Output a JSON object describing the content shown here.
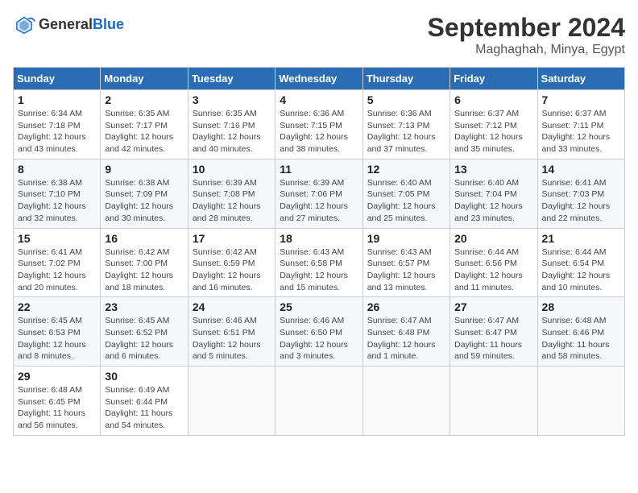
{
  "header": {
    "logo_general": "General",
    "logo_blue": "Blue",
    "month_title": "September 2024",
    "location": "Maghaghah, Minya, Egypt"
  },
  "days_of_week": [
    "Sunday",
    "Monday",
    "Tuesday",
    "Wednesday",
    "Thursday",
    "Friday",
    "Saturday"
  ],
  "weeks": [
    [
      {
        "day": "1",
        "sunrise": "6:34 AM",
        "sunset": "7:18 PM",
        "daylight": "12 hours and 43 minutes."
      },
      {
        "day": "2",
        "sunrise": "6:35 AM",
        "sunset": "7:17 PM",
        "daylight": "12 hours and 42 minutes."
      },
      {
        "day": "3",
        "sunrise": "6:35 AM",
        "sunset": "7:16 PM",
        "daylight": "12 hours and 40 minutes."
      },
      {
        "day": "4",
        "sunrise": "6:36 AM",
        "sunset": "7:15 PM",
        "daylight": "12 hours and 38 minutes."
      },
      {
        "day": "5",
        "sunrise": "6:36 AM",
        "sunset": "7:13 PM",
        "daylight": "12 hours and 37 minutes."
      },
      {
        "day": "6",
        "sunrise": "6:37 AM",
        "sunset": "7:12 PM",
        "daylight": "12 hours and 35 minutes."
      },
      {
        "day": "7",
        "sunrise": "6:37 AM",
        "sunset": "7:11 PM",
        "daylight": "12 hours and 33 minutes."
      }
    ],
    [
      {
        "day": "8",
        "sunrise": "6:38 AM",
        "sunset": "7:10 PM",
        "daylight": "12 hours and 32 minutes."
      },
      {
        "day": "9",
        "sunrise": "6:38 AM",
        "sunset": "7:09 PM",
        "daylight": "12 hours and 30 minutes."
      },
      {
        "day": "10",
        "sunrise": "6:39 AM",
        "sunset": "7:08 PM",
        "daylight": "12 hours and 28 minutes."
      },
      {
        "day": "11",
        "sunrise": "6:39 AM",
        "sunset": "7:06 PM",
        "daylight": "12 hours and 27 minutes."
      },
      {
        "day": "12",
        "sunrise": "6:40 AM",
        "sunset": "7:05 PM",
        "daylight": "12 hours and 25 minutes."
      },
      {
        "day": "13",
        "sunrise": "6:40 AM",
        "sunset": "7:04 PM",
        "daylight": "12 hours and 23 minutes."
      },
      {
        "day": "14",
        "sunrise": "6:41 AM",
        "sunset": "7:03 PM",
        "daylight": "12 hours and 22 minutes."
      }
    ],
    [
      {
        "day": "15",
        "sunrise": "6:41 AM",
        "sunset": "7:02 PM",
        "daylight": "12 hours and 20 minutes."
      },
      {
        "day": "16",
        "sunrise": "6:42 AM",
        "sunset": "7:00 PM",
        "daylight": "12 hours and 18 minutes."
      },
      {
        "day": "17",
        "sunrise": "6:42 AM",
        "sunset": "6:59 PM",
        "daylight": "12 hours and 16 minutes."
      },
      {
        "day": "18",
        "sunrise": "6:43 AM",
        "sunset": "6:58 PM",
        "daylight": "12 hours and 15 minutes."
      },
      {
        "day": "19",
        "sunrise": "6:43 AM",
        "sunset": "6:57 PM",
        "daylight": "12 hours and 13 minutes."
      },
      {
        "day": "20",
        "sunrise": "6:44 AM",
        "sunset": "6:56 PM",
        "daylight": "12 hours and 11 minutes."
      },
      {
        "day": "21",
        "sunrise": "6:44 AM",
        "sunset": "6:54 PM",
        "daylight": "12 hours and 10 minutes."
      }
    ],
    [
      {
        "day": "22",
        "sunrise": "6:45 AM",
        "sunset": "6:53 PM",
        "daylight": "12 hours and 8 minutes."
      },
      {
        "day": "23",
        "sunrise": "6:45 AM",
        "sunset": "6:52 PM",
        "daylight": "12 hours and 6 minutes."
      },
      {
        "day": "24",
        "sunrise": "6:46 AM",
        "sunset": "6:51 PM",
        "daylight": "12 hours and 5 minutes."
      },
      {
        "day": "25",
        "sunrise": "6:46 AM",
        "sunset": "6:50 PM",
        "daylight": "12 hours and 3 minutes."
      },
      {
        "day": "26",
        "sunrise": "6:47 AM",
        "sunset": "6:48 PM",
        "daylight": "12 hours and 1 minute."
      },
      {
        "day": "27",
        "sunrise": "6:47 AM",
        "sunset": "6:47 PM",
        "daylight": "11 hours and 59 minutes."
      },
      {
        "day": "28",
        "sunrise": "6:48 AM",
        "sunset": "6:46 PM",
        "daylight": "11 hours and 58 minutes."
      }
    ],
    [
      {
        "day": "29",
        "sunrise": "6:48 AM",
        "sunset": "6:45 PM",
        "daylight": "11 hours and 56 minutes."
      },
      {
        "day": "30",
        "sunrise": "6:49 AM",
        "sunset": "6:44 PM",
        "daylight": "11 hours and 54 minutes."
      },
      null,
      null,
      null,
      null,
      null
    ]
  ]
}
